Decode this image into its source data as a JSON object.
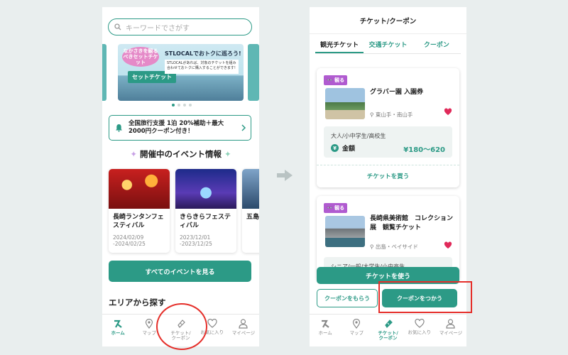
{
  "colors": {
    "accent": "#2c9a86",
    "highlight": "#e52f2a",
    "heart": "#e02a5a",
    "badge": "#b05bd0"
  },
  "left": {
    "search": {
      "placeholder": "キーワードでさがす",
      "icon": "search-icon"
    },
    "banner": {
      "badge": "なかさきを観るべきセットチケット",
      "brand_title": "STLOCALでおトクに巡ろう!",
      "note": "STLOCALがあれば、対象のチケットを組み合わせておトクに購入することができます!",
      "ticket_label": "セットチケット",
      "active_dot": 1,
      "dot_count": 4
    },
    "notice": {
      "text": "全国旅行支援 1泊 20%補助＋最大2000円クーポン付き！",
      "icon": "bell-icon"
    },
    "events_title": "開催中のイベント情報",
    "events": [
      {
        "name": "長崎ランタンフェスティバル",
        "date": "2024/02/09\n-2024/02/25"
      },
      {
        "name": "きらきらフェスティバル",
        "date": "2023/12/01\n-2023/12/25"
      },
      {
        "name": "五島",
        "date": ""
      }
    ],
    "see_all_button": "すべてのイベントを見る",
    "area_title": "エリアから探す",
    "tabs": [
      {
        "label": "ホーム",
        "icon": "home-logo-icon",
        "active": true
      },
      {
        "label": "マップ",
        "icon": "map-pin-icon",
        "active": false
      },
      {
        "label": "チケット/\nクーポン",
        "icon": "ticket-icon",
        "active": false
      },
      {
        "label": "お気に入り",
        "icon": "heart-icon",
        "active": false
      },
      {
        "label": "マイページ",
        "icon": "user-icon",
        "active": false
      }
    ]
  },
  "right": {
    "header_title": "チケット/クーポン",
    "segments": [
      "観光チケット",
      "交通チケット",
      "クーポン"
    ],
    "active_segment": 0,
    "tickets": [
      {
        "badge": "観る",
        "name": "グラバー園 入園券",
        "location": "東山手・南山手",
        "audience": "大人/小中学生/高校生",
        "price_label": "金額",
        "price_range": "¥180〜620",
        "buy_label": "チケットを買う"
      },
      {
        "badge": "観る",
        "name": "長崎県美術館　コレクション展　観覧チケット",
        "location": "出島・ベイサイド",
        "audience": "シニア/一般/大学生/小中高生"
      }
    ],
    "use_ticket_button": "チケットを使う",
    "get_coupon_button": "クーポンをもらう",
    "use_coupon_button": "クーポンをつかう",
    "tabs": [
      {
        "label": "ホーム",
        "icon": "home-logo-icon",
        "active": false
      },
      {
        "label": "マップ",
        "icon": "map-pin-icon",
        "active": false
      },
      {
        "label": "チケット/\nクーポン",
        "icon": "ticket-icon",
        "active": true
      },
      {
        "label": "お気に入り",
        "icon": "heart-icon",
        "active": false
      },
      {
        "label": "マイページ",
        "icon": "user-icon",
        "active": false
      }
    ]
  }
}
